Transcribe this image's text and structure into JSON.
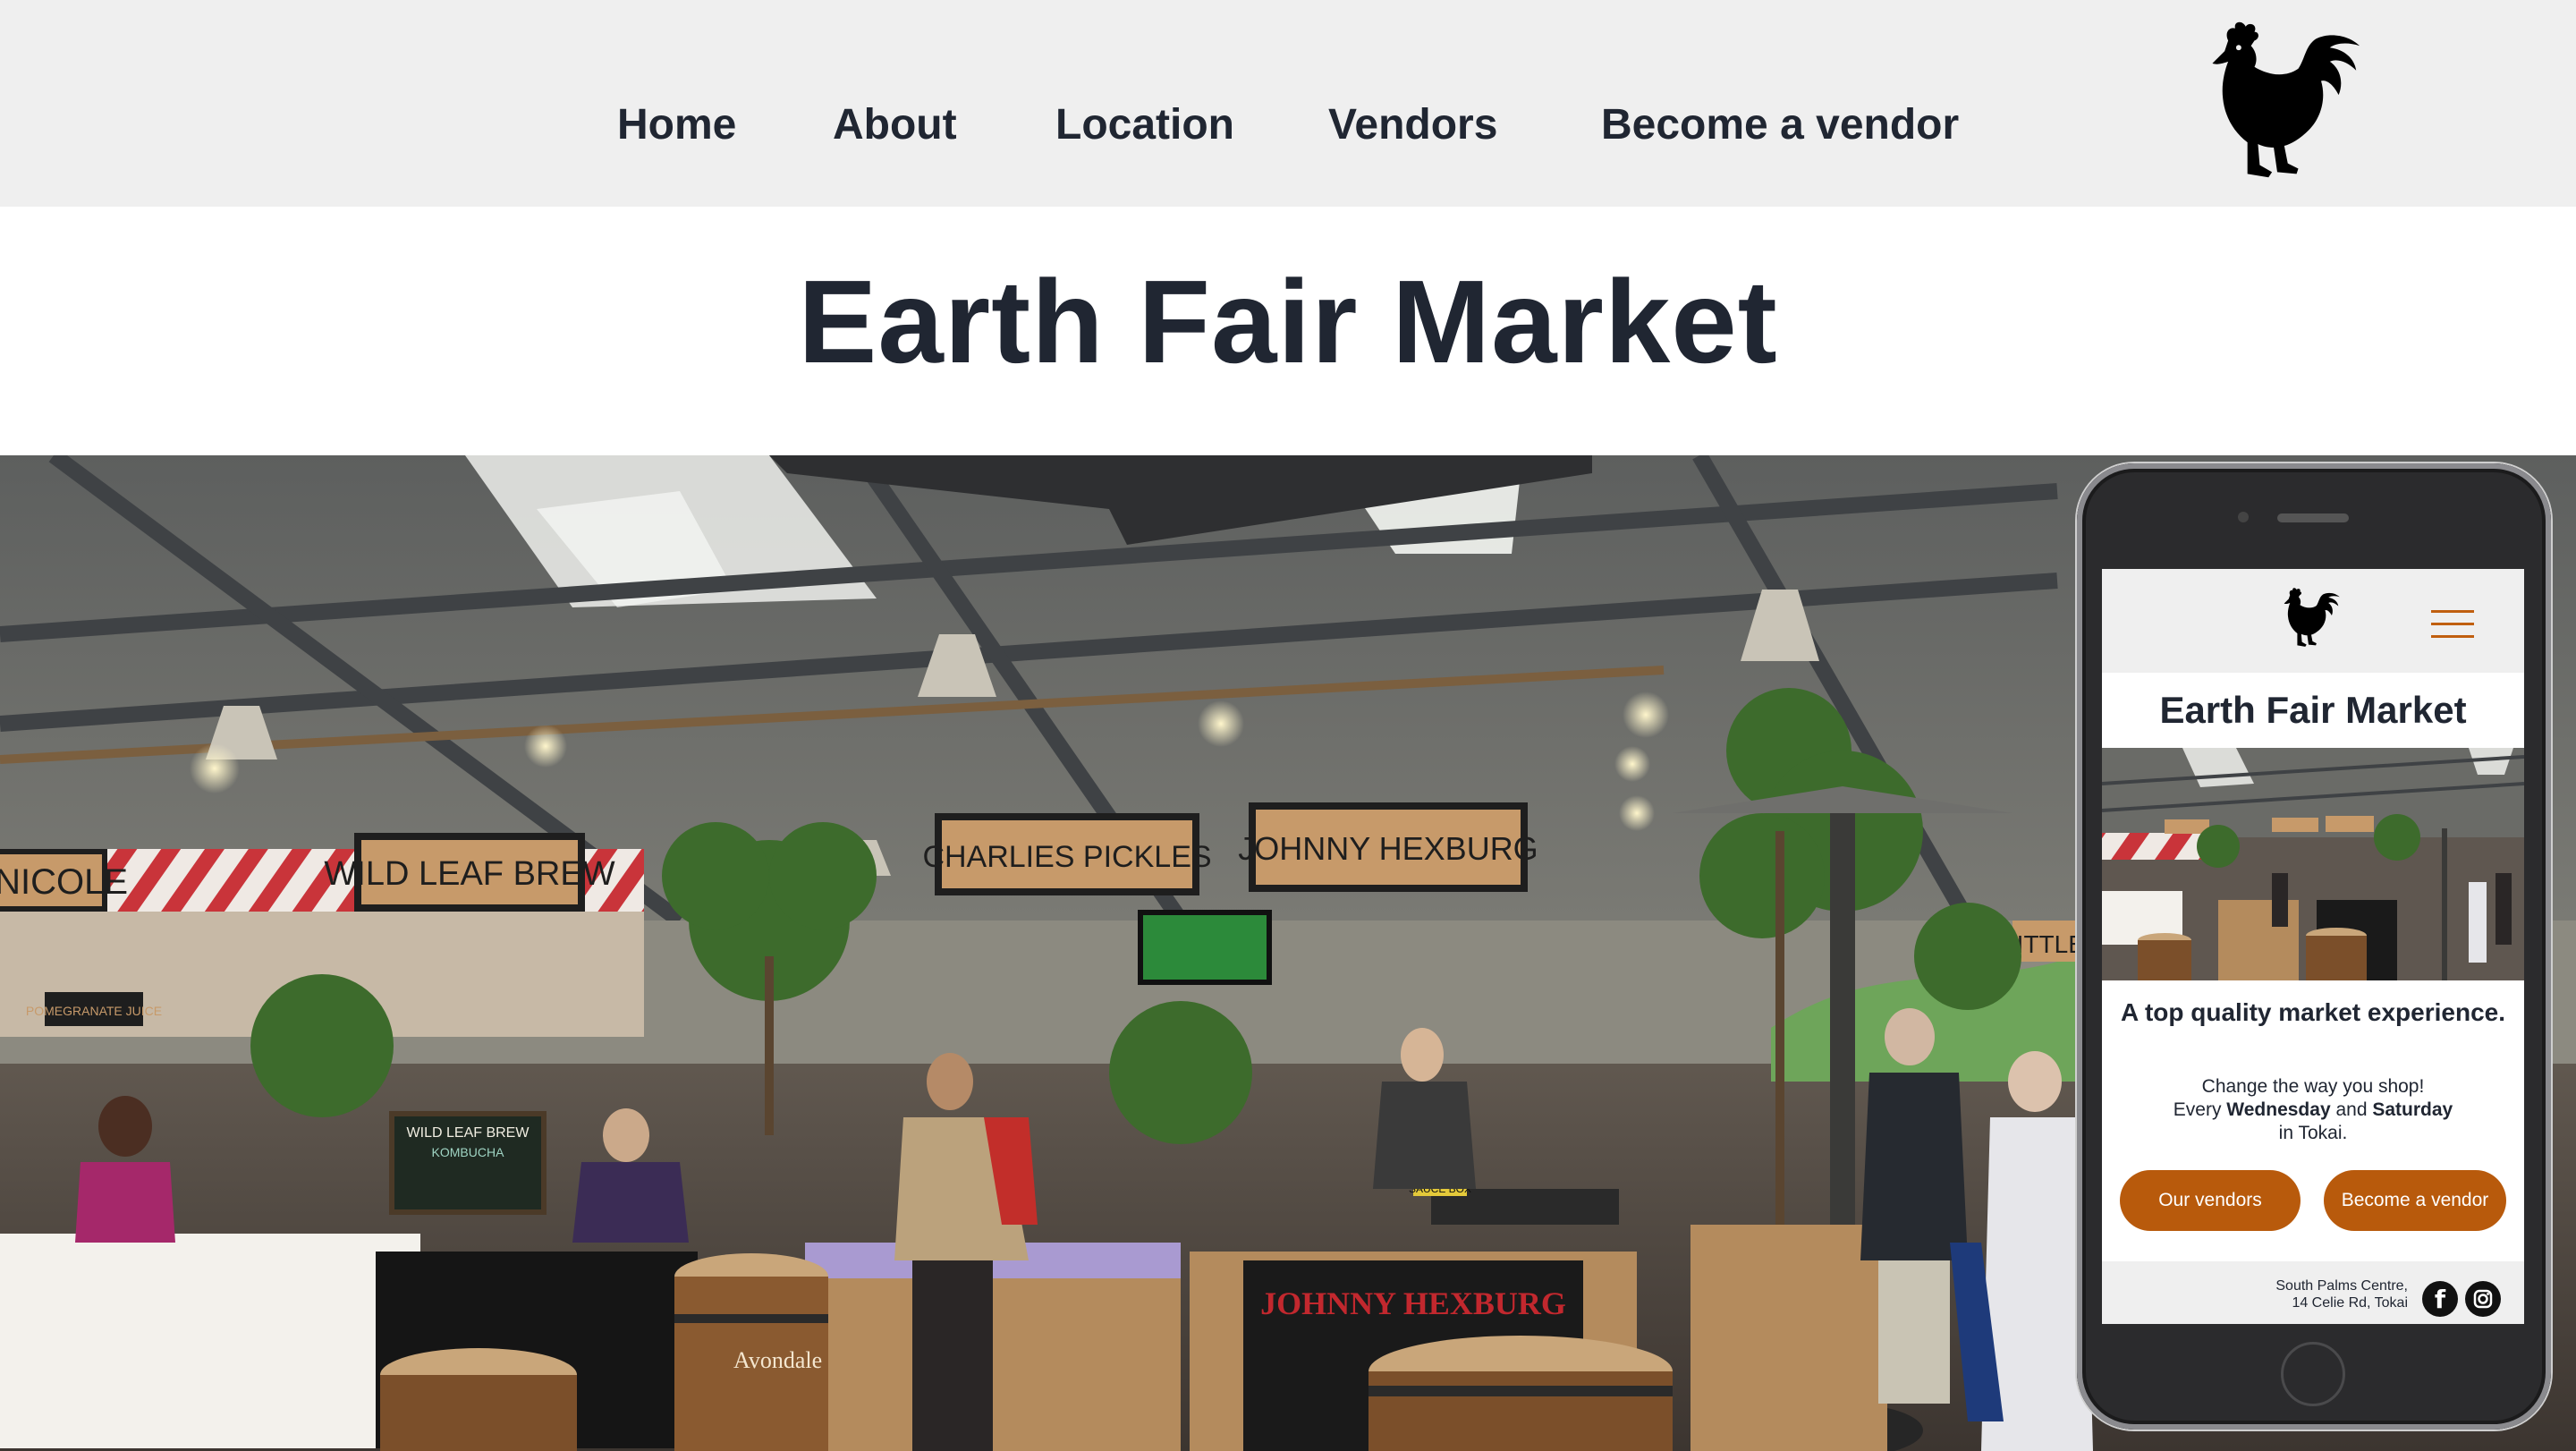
{
  "nav": {
    "links": [
      "Home",
      "About",
      "Location",
      "Vendors",
      "Become a vendor"
    ]
  },
  "logo": {
    "icon": "rooster-icon"
  },
  "page": {
    "title": "Earth Fair Market"
  },
  "hero_signs": {
    "nicole": "Y NICOLE",
    "wild_leaf": "WILD LEAF BREW",
    "charlies": "CHARLIES PICKLES",
    "johnny": "JOHNNY HEXBURG",
    "johnny_counter": "JOHNNY HEXBURG",
    "little": "LITTLE",
    "pomegranate": "POMEGRANATE JUICE",
    "chalkboard": "WILD LEAF BREW",
    "chalk_sub": "KOMBUCHA",
    "avondale": "Avondale",
    "sauce": "SAUCE BOX"
  },
  "mobile": {
    "title": "Earth Fair Market",
    "tagline": "A top quality market experience.",
    "sub_line1": "Change the way you shop!",
    "sub_every": "Every",
    "sub_day1": "Wednesday",
    "sub_and": "and",
    "sub_day2": "Saturday",
    "sub_line3": "in Tokai.",
    "btn_vendors": "Our vendors",
    "btn_become": "Become a vendor",
    "address_line1": "South Palms Centre,",
    "address_line2": "14 Celie Rd, Tokai",
    "social": [
      "facebook-icon",
      "instagram-icon"
    ],
    "menu_icon": "hamburger-menu-icon"
  },
  "colors": {
    "nav_bg": "#efefef",
    "text": "#202632",
    "accent": "#b85a0c"
  }
}
